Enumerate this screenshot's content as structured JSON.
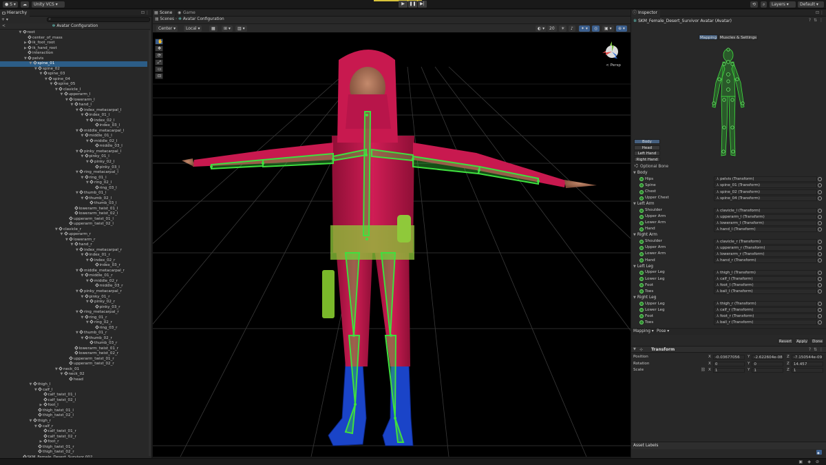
{
  "toolbar": {
    "account_label": "S",
    "vcs_label": "Unity VCS",
    "layers_label": "Layers",
    "layout_label": "Default"
  },
  "hierarchy": {
    "tab_label": "Hierarchy",
    "scene_label": "Avatar Configuration",
    "rows": [
      {
        "label": "root",
        "depth": 1,
        "arrow": "▼"
      },
      {
        "label": "center_of_mass",
        "depth": 2,
        "arrow": ""
      },
      {
        "label": "ik_foot_root",
        "depth": 2,
        "arrow": "▶"
      },
      {
        "label": "ik_hand_root",
        "depth": 2,
        "arrow": "▶"
      },
      {
        "label": "interaction",
        "depth": 2,
        "arrow": ""
      },
      {
        "label": "pelvis",
        "depth": 2,
        "arrow": "▼"
      },
      {
        "label": "spine_01",
        "depth": 3,
        "arrow": "▼",
        "sel": true
      },
      {
        "label": "spine_02",
        "depth": 4,
        "arrow": "▼"
      },
      {
        "label": "spine_03",
        "depth": 5,
        "arrow": "▼"
      },
      {
        "label": "spine_04",
        "depth": 6,
        "arrow": "▼"
      },
      {
        "label": "spine_05",
        "depth": 7,
        "arrow": "▼"
      },
      {
        "label": "clavicle_l",
        "depth": 8,
        "arrow": "▼"
      },
      {
        "label": "upperarm_l",
        "depth": 9,
        "arrow": "▼"
      },
      {
        "label": "lowerarm_l",
        "depth": 10,
        "arrow": "▼"
      },
      {
        "label": "hand_l",
        "depth": 11,
        "arrow": "▼"
      },
      {
        "label": "index_metacarpal_l",
        "depth": 12,
        "arrow": "▼"
      },
      {
        "label": "index_01_l",
        "depth": 13,
        "arrow": "▼"
      },
      {
        "label": "index_02_l",
        "depth": 14,
        "arrow": "▼"
      },
      {
        "label": "index_03_l",
        "depth": 15,
        "arrow": ""
      },
      {
        "label": "middle_metacarpal_l",
        "depth": 12,
        "arrow": "▼"
      },
      {
        "label": "middle_01_l",
        "depth": 13,
        "arrow": "▼"
      },
      {
        "label": "middle_02_l",
        "depth": 14,
        "arrow": "▼"
      },
      {
        "label": "middle_03_l",
        "depth": 15,
        "arrow": ""
      },
      {
        "label": "pinky_metacarpal_l",
        "depth": 12,
        "arrow": "▼"
      },
      {
        "label": "pinky_01_l",
        "depth": 13,
        "arrow": "▼"
      },
      {
        "label": "pinky_02_l",
        "depth": 14,
        "arrow": "▼"
      },
      {
        "label": "pinky_03_l",
        "depth": 15,
        "arrow": ""
      },
      {
        "label": "ring_metacarpal_l",
        "depth": 12,
        "arrow": "▼"
      },
      {
        "label": "ring_01_l",
        "depth": 13,
        "arrow": "▼"
      },
      {
        "label": "ring_02_l",
        "depth": 14,
        "arrow": "▼"
      },
      {
        "label": "ring_03_l",
        "depth": 15,
        "arrow": ""
      },
      {
        "label": "thumb_01_l",
        "depth": 12,
        "arrow": "▼"
      },
      {
        "label": "thumb_02_l",
        "depth": 13,
        "arrow": "▼"
      },
      {
        "label": "thumb_03_l",
        "depth": 14,
        "arrow": ""
      },
      {
        "label": "lowerarm_twist_01_l",
        "depth": 11,
        "arrow": ""
      },
      {
        "label": "lowerarm_twist_02_l",
        "depth": 11,
        "arrow": ""
      },
      {
        "label": "upperarm_twist_01_l",
        "depth": 10,
        "arrow": ""
      },
      {
        "label": "upperarm_twist_02_l",
        "depth": 10,
        "arrow": ""
      },
      {
        "label": "clavicle_r",
        "depth": 8,
        "arrow": "▼"
      },
      {
        "label": "upperarm_r",
        "depth": 9,
        "arrow": "▼"
      },
      {
        "label": "lowerarm_r",
        "depth": 10,
        "arrow": "▼"
      },
      {
        "label": "hand_r",
        "depth": 11,
        "arrow": "▼"
      },
      {
        "label": "index_metacarpal_r",
        "depth": 12,
        "arrow": "▼"
      },
      {
        "label": "index_01_r",
        "depth": 13,
        "arrow": "▼"
      },
      {
        "label": "index_02_r",
        "depth": 14,
        "arrow": "▼"
      },
      {
        "label": "index_03_r",
        "depth": 15,
        "arrow": ""
      },
      {
        "label": "middle_metacarpal_r",
        "depth": 12,
        "arrow": "▼"
      },
      {
        "label": "middle_01_r",
        "depth": 13,
        "arrow": "▼"
      },
      {
        "label": "middle_02_r",
        "depth": 14,
        "arrow": "▼"
      },
      {
        "label": "middle_03_r",
        "depth": 15,
        "arrow": ""
      },
      {
        "label": "pinky_metacarpal_r",
        "depth": 12,
        "arrow": "▼"
      },
      {
        "label": "pinky_01_r",
        "depth": 13,
        "arrow": "▼"
      },
      {
        "label": "pinky_02_r",
        "depth": 14,
        "arrow": "▼"
      },
      {
        "label": "pinky_03_r",
        "depth": 15,
        "arrow": ""
      },
      {
        "label": "ring_metacarpal_r",
        "depth": 12,
        "arrow": "▼"
      },
      {
        "label": "ring_01_r",
        "depth": 13,
        "arrow": "▼"
      },
      {
        "label": "ring_02_r",
        "depth": 14,
        "arrow": "▼"
      },
      {
        "label": "ring_03_r",
        "depth": 15,
        "arrow": ""
      },
      {
        "label": "thumb_01_r",
        "depth": 12,
        "arrow": "▼"
      },
      {
        "label": "thumb_02_r",
        "depth": 13,
        "arrow": "▼"
      },
      {
        "label": "thumb_03_r",
        "depth": 14,
        "arrow": ""
      },
      {
        "label": "lowerarm_twist_01_r",
        "depth": 11,
        "arrow": ""
      },
      {
        "label": "lowerarm_twist_02_r",
        "depth": 11,
        "arrow": ""
      },
      {
        "label": "upperarm_twist_01_r",
        "depth": 10,
        "arrow": ""
      },
      {
        "label": "upperarm_twist_02_r",
        "depth": 10,
        "arrow": ""
      },
      {
        "label": "neck_01",
        "depth": 8,
        "arrow": "▼"
      },
      {
        "label": "neck_02",
        "depth": 9,
        "arrow": "▼"
      },
      {
        "label": "head",
        "depth": 10,
        "arrow": ""
      },
      {
        "label": "thigh_l",
        "depth": 3,
        "arrow": "▼"
      },
      {
        "label": "calf_l",
        "depth": 4,
        "arrow": "▼"
      },
      {
        "label": "calf_twist_01_l",
        "depth": 5,
        "arrow": ""
      },
      {
        "label": "calf_twist_02_l",
        "depth": 5,
        "arrow": ""
      },
      {
        "label": "foot_l",
        "depth": 5,
        "arrow": "▶"
      },
      {
        "label": "thigh_twist_01_l",
        "depth": 4,
        "arrow": ""
      },
      {
        "label": "thigh_twist_02_l",
        "depth": 4,
        "arrow": ""
      },
      {
        "label": "thigh_r",
        "depth": 3,
        "arrow": "▼"
      },
      {
        "label": "calf_r",
        "depth": 4,
        "arrow": "▼"
      },
      {
        "label": "calf_twist_01_r",
        "depth": 5,
        "arrow": ""
      },
      {
        "label": "calf_twist_02_r",
        "depth": 5,
        "arrow": ""
      },
      {
        "label": "foot_r",
        "depth": 5,
        "arrow": "▶"
      },
      {
        "label": "thigh_twist_01_r",
        "depth": 4,
        "arrow": ""
      },
      {
        "label": "thigh_twist_02_r",
        "depth": 4,
        "arrow": ""
      },
      {
        "label": "SKM_Female_Desert_Survivor 002",
        "depth": 1,
        "arrow": ""
      }
    ]
  },
  "scene": {
    "tab_scene": "Scene",
    "tab_game": "Game",
    "breadcrumb_root": "Scenes",
    "breadcrumb_current": "Avatar Configuration",
    "pivot_label": "Center",
    "space_label": "Local",
    "gizmo_count": "20",
    "persp_label": "< Persp"
  },
  "inspector": {
    "tab_label": "Inspector",
    "title": "SKM_Female_Desert_Survivor Avatar (Avatar)",
    "tab_mapping": "Mapping",
    "tab_muscles": "Muscles & Settings",
    "body_buttons": [
      "Body",
      "Head",
      "Left Hand",
      "Right Hand"
    ],
    "optional_bone": "Optional Bone",
    "groups": [
      {
        "name": "Body",
        "bones": [
          {
            "label": "Hips",
            "value": "pelvis (Transform)"
          },
          {
            "label": "Spine",
            "value": "spine_01 (Transform)"
          },
          {
            "label": "Chest",
            "value": "spine_02 (Transform)"
          },
          {
            "label": "Upper Chest",
            "value": "spine_04 (Transform)"
          }
        ]
      },
      {
        "name": "Left Arm",
        "bones": [
          {
            "label": "Shoulder",
            "value": "clavicle_l (Transform)"
          },
          {
            "label": "Upper Arm",
            "value": "upperarm_l (Transform)"
          },
          {
            "label": "Lower Arm",
            "value": "lowerarm_l (Transform)"
          },
          {
            "label": "Hand",
            "value": "hand_l (Transform)"
          }
        ]
      },
      {
        "name": "Right Arm",
        "bones": [
          {
            "label": "Shoulder",
            "value": "clavicle_r (Transform)"
          },
          {
            "label": "Upper Arm",
            "value": "upperarm_r (Transform)"
          },
          {
            "label": "Lower Arm",
            "value": "lowerarm_r (Transform)"
          },
          {
            "label": "Hand",
            "value": "hand_r (Transform)"
          }
        ]
      },
      {
        "name": "Left Leg",
        "bones": [
          {
            "label": "Upper Leg",
            "value": "thigh_l (Transform)"
          },
          {
            "label": "Lower Leg",
            "value": "calf_l (Transform)"
          },
          {
            "label": "Foot",
            "value": "foot_l (Transform)"
          },
          {
            "label": "Toes",
            "value": "ball_l (Transform)"
          }
        ]
      },
      {
        "name": "Right Leg",
        "bones": [
          {
            "label": "Upper Leg",
            "value": "thigh_r (Transform)"
          },
          {
            "label": "Lower Leg",
            "value": "calf_r (Transform)"
          },
          {
            "label": "Foot",
            "value": "foot_r (Transform)"
          },
          {
            "label": "Toes",
            "value": "ball_r (Transform)"
          }
        ]
      }
    ],
    "mapping_menu": "Mapping",
    "pose_menu": "Pose",
    "revert_label": "Revert",
    "apply_label": "Apply",
    "done_label": "Done",
    "transform": {
      "title": "Transform",
      "position_label": "Position",
      "rotation_label": "Rotation",
      "scale_label": "Scale",
      "position": [
        "-0.03677056",
        "-2.622604e-08",
        "-7.150544e-09"
      ],
      "rotation": [
        "0",
        "0",
        "14.457"
      ],
      "scale": [
        "1",
        "1",
        "1"
      ]
    },
    "asset_labels": "Asset Labels"
  },
  "colors": {
    "accent": "#2c5d87",
    "bone_green": "#3fe03f",
    "suit_red": "#c8194f",
    "boot_blue": "#1a44c8"
  }
}
